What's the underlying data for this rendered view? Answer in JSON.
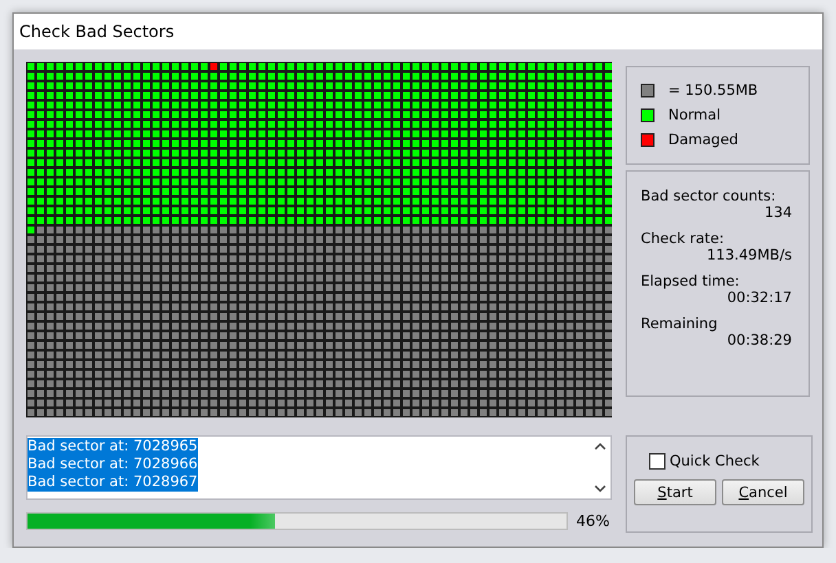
{
  "window": {
    "title": "Check Bad Sectors"
  },
  "legend": [
    {
      "label": "= 150.55MB",
      "color": "#808080"
    },
    {
      "label": "Normal",
      "color": "#00ff00"
    },
    {
      "label": "Damaged",
      "color": "#ff0000"
    }
  ],
  "stats": [
    {
      "label": "Bad sector counts:",
      "value": "134"
    },
    {
      "label": "Check rate:",
      "value": "113.49MB/s"
    },
    {
      "label": "Elapsed time:",
      "value": "00:32:17"
    },
    {
      "label": "Remaining",
      "value": "00:38:29"
    }
  ],
  "log": {
    "lines": [
      {
        "text": "Bad sector at: 7028965",
        "selected": true
      },
      {
        "text": "Bad sector at: 7028966",
        "selected": true
      },
      {
        "text": "Bad sector at: 7028967",
        "selected": true
      }
    ]
  },
  "progress": {
    "level": 0.46,
    "reading": "46%"
  },
  "quick_check": {
    "label": "Quick Check",
    "checked": false
  },
  "buttons": [
    {
      "label": "Start"
    },
    {
      "label": "Cancel"
    }
  ]
}
